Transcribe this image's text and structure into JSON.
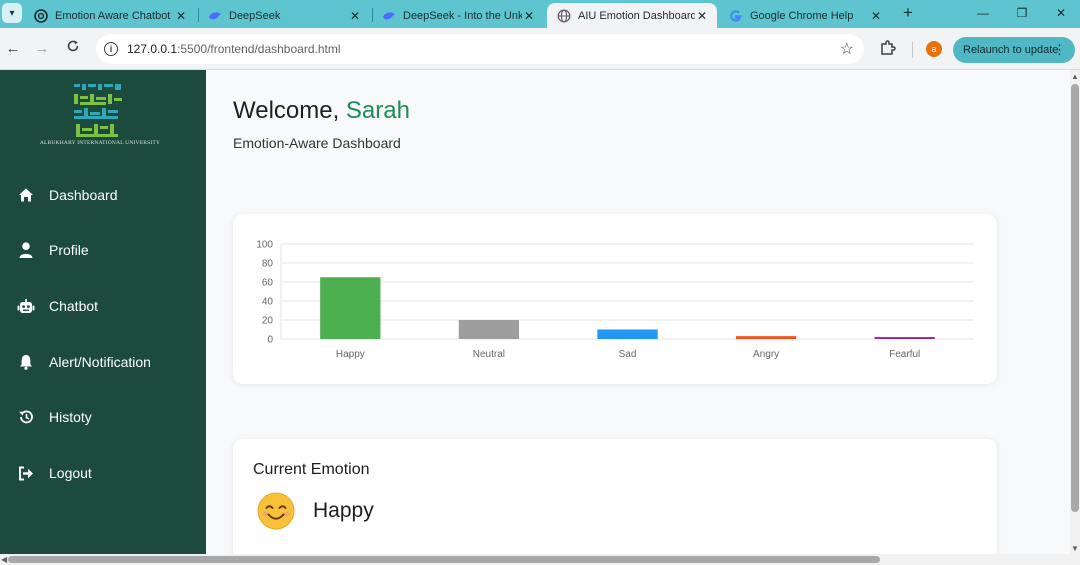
{
  "browser": {
    "tabs": [
      {
        "title": "Emotion Aware Chatbot (",
        "favicon": "openai-icon"
      },
      {
        "title": "DeepSeek",
        "favicon": "deepseek-icon"
      },
      {
        "title": "DeepSeek - Into the Unkn",
        "favicon": "deepseek-icon"
      },
      {
        "title": "AIU Emotion Dashboard",
        "favicon": "globe-icon",
        "active": true
      },
      {
        "title": "Google Chrome Help",
        "favicon": "google-icon"
      }
    ],
    "url_host": "127.0.0.1",
    "url_path": ":5500/frontend/dashboard.html",
    "profile_initial": "a",
    "relaunch_label": "Relaunch to update"
  },
  "sidebar": {
    "logo_caption": "ALBUKHARY INTERNATIONAL UNIVERSITY",
    "items": [
      {
        "label": "Dashboard",
        "icon": "home-icon"
      },
      {
        "label": "Profile",
        "icon": "user-icon"
      },
      {
        "label": "Chatbot",
        "icon": "robot-icon"
      },
      {
        "label": "Alert/Notification",
        "icon": "bell-icon"
      },
      {
        "label": "Histoty",
        "icon": "history-icon"
      },
      {
        "label": "Logout",
        "icon": "logout-icon"
      }
    ]
  },
  "main": {
    "welcome_prefix": "Welcome, ",
    "user_name": "Sarah",
    "subtitle": "Emotion-Aware Dashboard",
    "current_emotion_heading": "Current Emotion",
    "current_emotion": "Happy",
    "current_emotion_icon": "smiling-face-icon"
  },
  "colors": {
    "sidebar_bg": "#1c4a3c",
    "accent_name": "#1e8a55",
    "tabbar_bg": "#5ec5d0"
  },
  "chart_data": {
    "type": "bar",
    "categories": [
      "Happy",
      "Neutral",
      "Sad",
      "Angry",
      "Fearful"
    ],
    "values": [
      65,
      20,
      10,
      3,
      2
    ],
    "colors": [
      "#4caf50",
      "#9e9e9e",
      "#2196f3",
      "#f4511e",
      "#8e24aa"
    ],
    "yticks": [
      0,
      20,
      40,
      60,
      80,
      100
    ],
    "ylim": [
      0,
      100
    ],
    "grid": true,
    "title": "",
    "xlabel": "",
    "ylabel": ""
  }
}
